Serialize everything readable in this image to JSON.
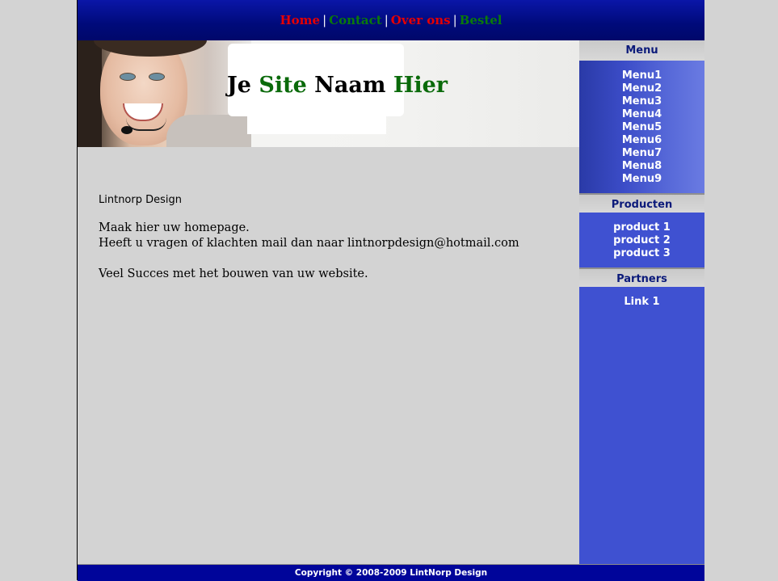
{
  "nav": {
    "items": [
      {
        "label": "Home",
        "color": "#e60000"
      },
      {
        "label": "Contact",
        "color": "#0a7a0a"
      },
      {
        "label": "Over ons",
        "color": "#e60000"
      },
      {
        "label": "Bestel",
        "color": "#0a7a0a"
      }
    ],
    "separator": "|"
  },
  "header": {
    "title_parts": [
      {
        "text": "Je ",
        "color": "#000000"
      },
      {
        "text": "Site ",
        "color": "#0a6a0a"
      },
      {
        "text": "Naam ",
        "color": "#000000"
      },
      {
        "text": "Hier",
        "color": "#0a6a0a"
      }
    ]
  },
  "content": {
    "company": "Lintnorp Design",
    "line1": "Maak hier uw homepage.",
    "line2": "Heeft u vragen of klachten mail dan naar lintnorpdesign@hotmail.com",
    "line3": "Veel Succes met het bouwen van uw website."
  },
  "sidebar": {
    "menu_title": "Menu",
    "menu_items": [
      "Menu1",
      "Menu2",
      "Menu3",
      "Menu4",
      "Menu5",
      "Menu6",
      "Menu7",
      "Menu8",
      "Menu9"
    ],
    "products_title": "Producten",
    "products": [
      "product 1",
      "product 2",
      "product 3"
    ],
    "partners_title": "Partners",
    "partners": [
      "Link 1"
    ]
  },
  "footer": {
    "copyright": "Copyright © 2008-2009 LintNorp Design"
  }
}
